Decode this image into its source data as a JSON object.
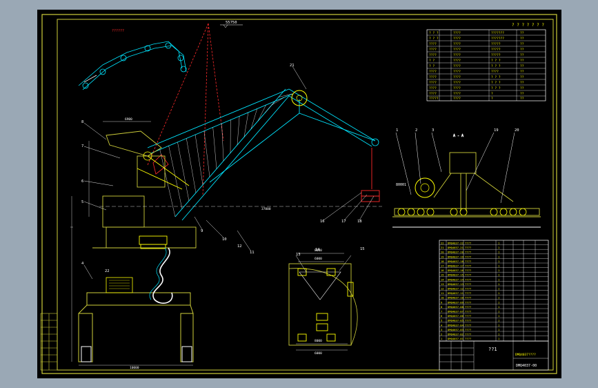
{
  "drawing": {
    "title_cell": "??1",
    "part_number": "DMQ4037-00",
    "part_number_short": "DMQ4037????",
    "inset_label": "??????",
    "elevation_top": "55750",
    "param_table_title": "? ? ? ? ? ? ?",
    "balloons": [
      "1",
      "2",
      "3",
      "4",
      "5",
      "6",
      "7",
      "8",
      "9",
      "10",
      "11",
      "12",
      "13",
      "14",
      "15",
      "16",
      "17",
      "18",
      "19",
      "20",
      "21",
      "22"
    ],
    "section_label": "A - A",
    "dims": {
      "boom_reach": "37000",
      "counterweight": "6900",
      "base_span": "10000",
      "span_a": "8000",
      "span_b": "6000",
      "lower_a": "8000",
      "lower_b": "6000",
      "rail_height": "8000",
      "rail_gauge": "10000"
    },
    "colors": {
      "frame": "#cfcf3a",
      "structure": "#00e5ff",
      "highlight": "#ffff00",
      "red": "#ff2a2a",
      "white": "#ffffff"
    }
  }
}
